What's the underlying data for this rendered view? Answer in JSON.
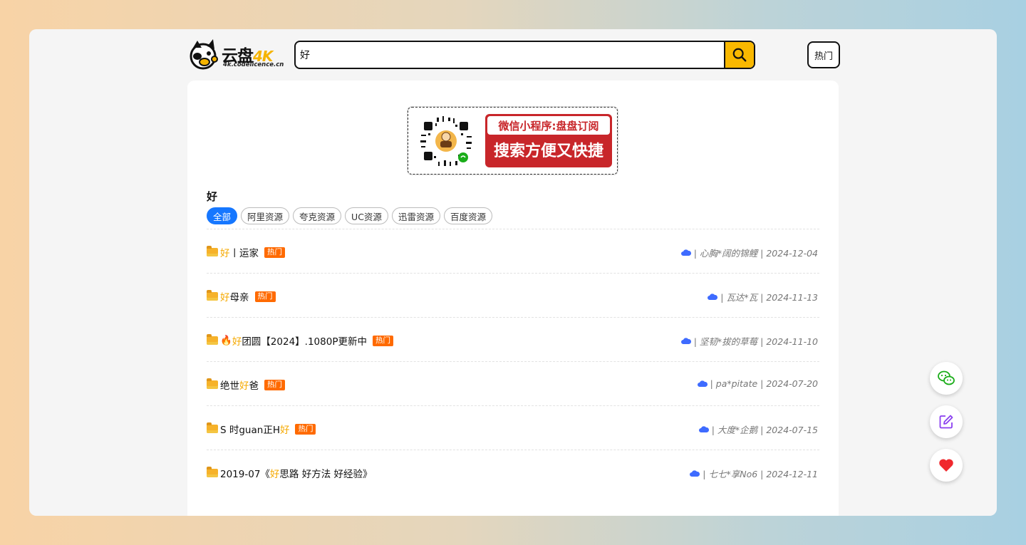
{
  "brand": {
    "name": "云盘",
    "name_suffix": "4K",
    "domain": "4k.codelicence.cn"
  },
  "search": {
    "value": "好",
    "placeholder": ""
  },
  "header": {
    "hot_button": "热门"
  },
  "banner": {
    "line1": "微信小程序:盘盘订阅",
    "line2": "搜索方便又快捷"
  },
  "query_title": "好",
  "filters": [
    {
      "label": "全部",
      "active": true
    },
    {
      "label": "阿里资源",
      "active": false
    },
    {
      "label": "夸克资源",
      "active": false
    },
    {
      "label": "UC资源",
      "active": false
    },
    {
      "label": "迅雷资源",
      "active": false
    },
    {
      "label": "百度资源",
      "active": false
    }
  ],
  "results": [
    {
      "pre": "",
      "hl": "好",
      "post": "丨运家",
      "hot": "热门",
      "meta": "| 心胸*阔的锦鲤 | 2024-12-04"
    },
    {
      "pre": "",
      "hl": "好",
      "post": "母亲",
      "hot": "热门",
      "meta": "| 瓦达*瓦 | 2024-11-13"
    },
    {
      "pre": "🔥",
      "hl": "好",
      "post": "团圆【2024】.1080P更新中",
      "hot": "热门",
      "meta": "| 坚韧*拔的草莓 | 2024-11-10"
    },
    {
      "pre": "绝世",
      "hl": "好",
      "post": "爸",
      "hot": "热门",
      "meta": "| pa*pitate | 2024-07-20"
    },
    {
      "pre": "S 时guan正H",
      "hl": "好",
      "post": "",
      "hot": "热门",
      "meta": "| 大度*企鹅 | 2024-07-15"
    },
    {
      "pre": "2019-07《",
      "hl": "好",
      "post": "思路 好方法 好经验》",
      "hot": "",
      "meta": "| 七七*享No6 | 2024-12-11"
    }
  ],
  "colors": {
    "accent": "#f9b800",
    "primary": "#1677ff",
    "hot_tag": "#ff6a00",
    "promo": "#c8262a"
  },
  "icons": {
    "search": "search-icon",
    "wechat": "wechat-icon",
    "edit": "edit-icon",
    "heart": "heart-icon"
  }
}
